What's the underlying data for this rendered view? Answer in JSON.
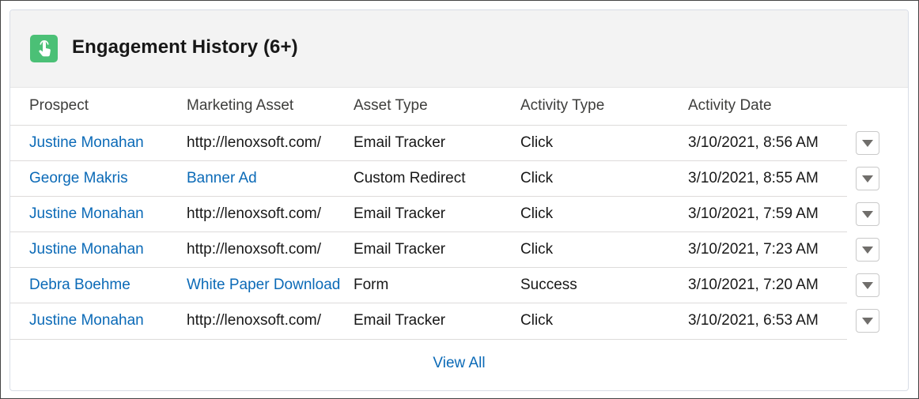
{
  "card": {
    "title": "Engagement History (6+)",
    "icon": "touch-hand-icon",
    "icon_color": "#4bc076"
  },
  "table": {
    "columns": [
      "Prospect",
      "Marketing Asset",
      "Asset Type",
      "Activity Type",
      "Activity Date"
    ],
    "rows": [
      {
        "prospect": "Justine Monahan",
        "asset": "http://lenoxsoft.com/",
        "asset_is_link": false,
        "asset_type": "Email Tracker",
        "activity_type": "Click",
        "date": "3/10/2021, 8:56 AM"
      },
      {
        "prospect": "George Makris",
        "asset": "Banner Ad",
        "asset_is_link": true,
        "asset_type": "Custom Redirect",
        "activity_type": "Click",
        "date": "3/10/2021, 8:55 AM"
      },
      {
        "prospect": "Justine Monahan",
        "asset": "http://lenoxsoft.com/",
        "asset_is_link": false,
        "asset_type": "Email Tracker",
        "activity_type": "Click",
        "date": "3/10/2021, 7:59 AM"
      },
      {
        "prospect": "Justine Monahan",
        "asset": "http://lenoxsoft.com/",
        "asset_is_link": false,
        "asset_type": "Email Tracker",
        "activity_type": "Click",
        "date": "3/10/2021, 7:23 AM"
      },
      {
        "prospect": "Debra Boehme",
        "asset": "White Paper Download",
        "asset_is_link": true,
        "asset_type": "Form",
        "activity_type": "Success",
        "date": "3/10/2021, 7:20 AM"
      },
      {
        "prospect": "Justine Monahan",
        "asset": "http://lenoxsoft.com/",
        "asset_is_link": false,
        "asset_type": "Email Tracker",
        "activity_type": "Click",
        "date": "3/10/2021, 6:53 AM"
      }
    ],
    "row_action_icon": "chevron-down-icon"
  },
  "footer": {
    "view_all_label": "View All"
  },
  "colors": {
    "link": "#0b6ab7",
    "header_bg": "#f3f3f3"
  }
}
